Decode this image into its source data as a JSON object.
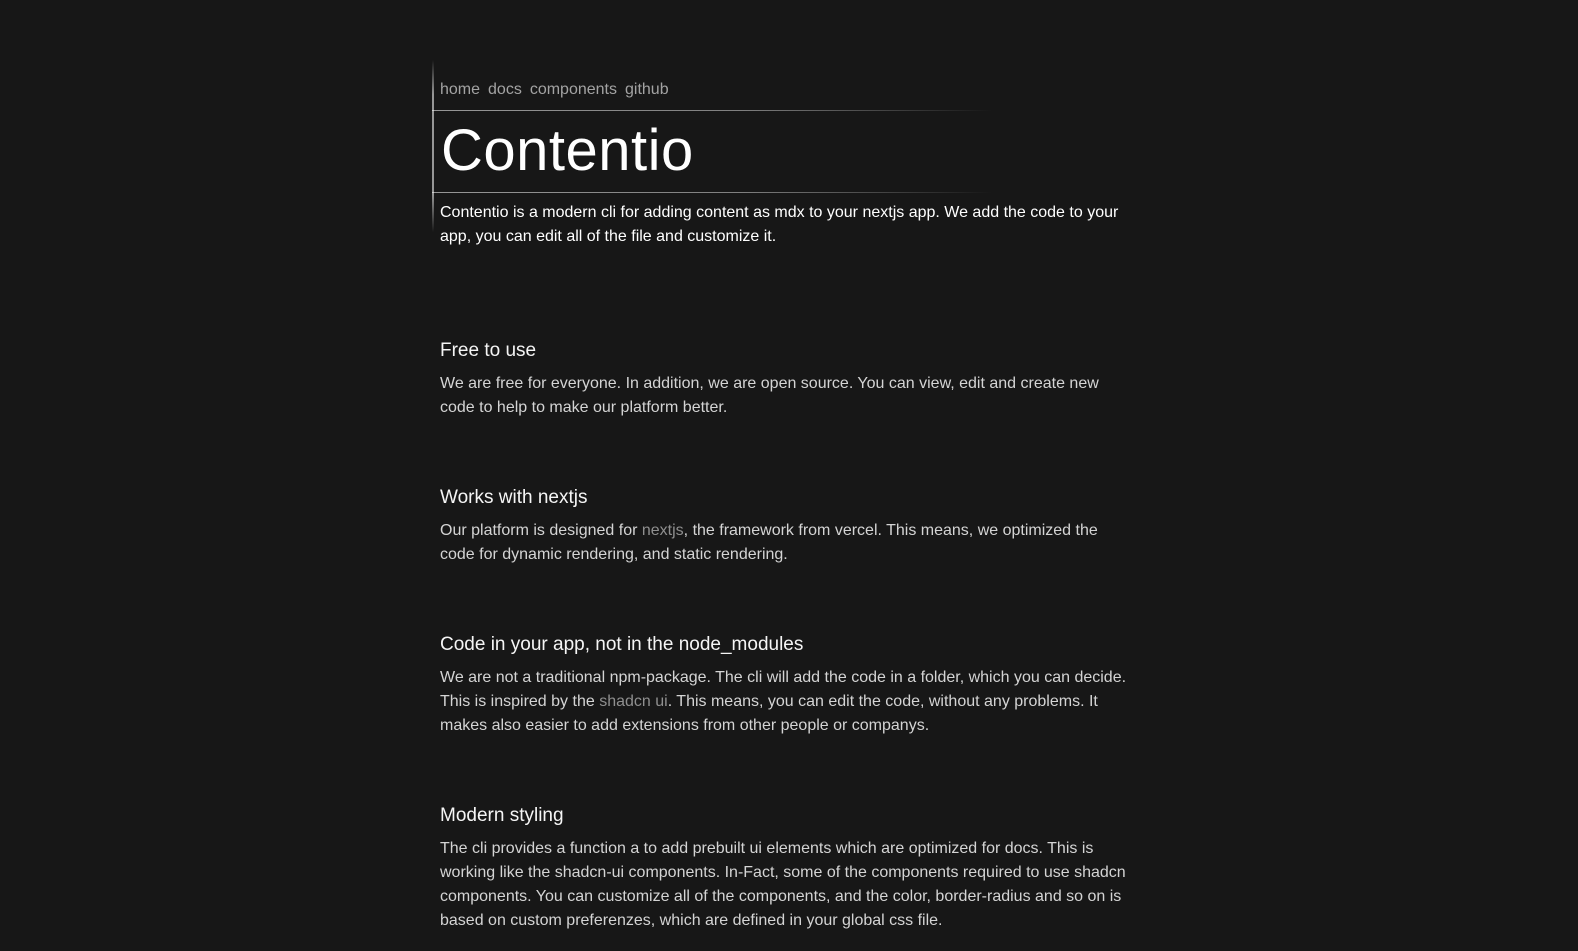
{
  "nav": {
    "items": [
      "home",
      "docs",
      "components",
      "github"
    ]
  },
  "hero": {
    "title": "Contentio",
    "description": "Contentio is a modern cli for adding content as mdx to your nextjs app. We add the code to your app, you can edit all of the file and customize it."
  },
  "sections": [
    {
      "title": "Free to use",
      "text": "We are free for everyone. In addition, we are open source. You can view, edit and create new code to help to make our platform better."
    },
    {
      "title": "Works with nextjs",
      "text_before": "Our platform is designed for ",
      "link": "nextjs",
      "text_after": ", the framework from vercel. This means, we optimized the code for dynamic rendering, and static rendering."
    },
    {
      "title": "Code in your app, not in the node_modules",
      "text_before": "We are not a traditional npm-package. The cli will add the code in a folder, which you can decide. This is inspired by the ",
      "link": "shadcn ui",
      "text_after": ". This means, you can edit the code, without any problems. It makes also easier to add extensions from other people or companys."
    },
    {
      "title": "Modern styling",
      "text": "The cli provides a function a to add prebuilt ui elements which are optimized for docs. This is working like the shadcn-ui components. In-Fact, some of the components required to use shadcn components. You can customize all of the components, and the color, border-radius and so on is based on custom preferenzes, which are defined in your global css file."
    }
  ],
  "colors": {
    "background": "#171717",
    "text": "#ffffff",
    "muted": "#a3a3a3",
    "link": "#8f8f8f"
  }
}
